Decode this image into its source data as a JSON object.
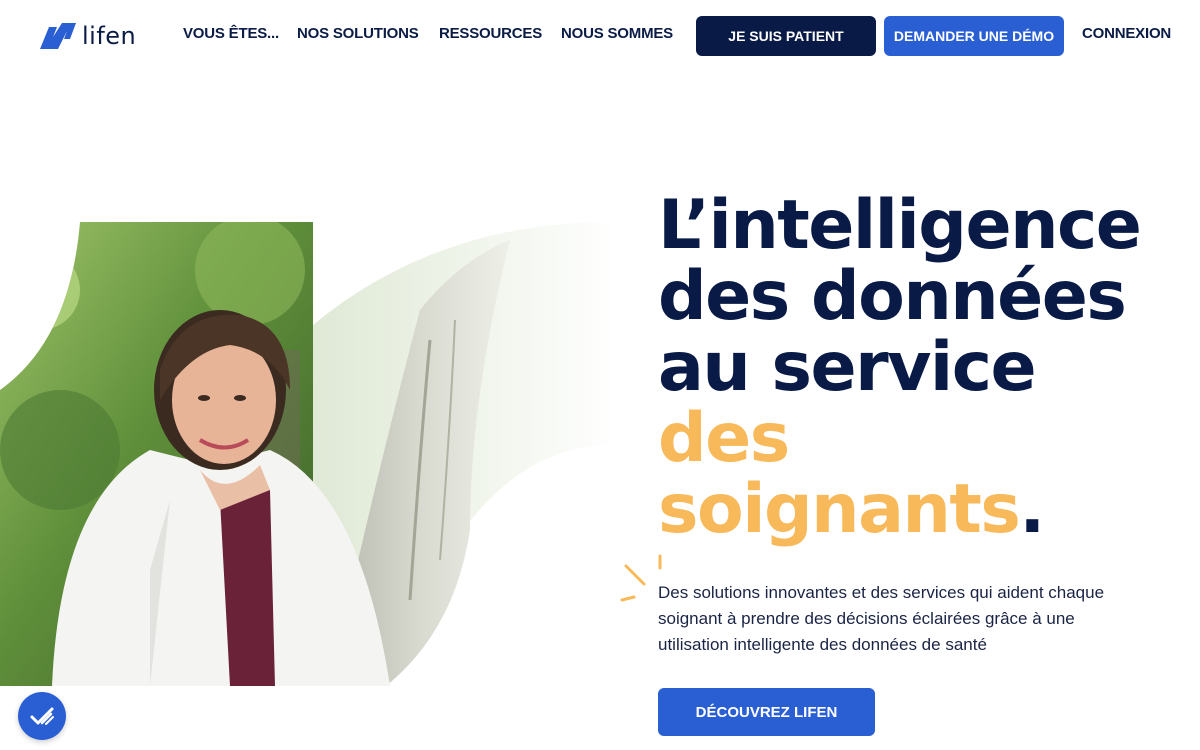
{
  "brand": {
    "name": "lifen",
    "color": "#2a5fd4"
  },
  "nav": {
    "items": [
      {
        "label": "VOUS ÊTES..."
      },
      {
        "label": "NOS SOLUTIONS"
      },
      {
        "label": "RESSOURCES"
      },
      {
        "label": "NOUS SOMMES"
      }
    ],
    "patient_button": "JE SUIS PATIENT",
    "demo_button": "DEMANDER UNE DÉMO",
    "login": "CONNEXION"
  },
  "hero": {
    "headline_lines": [
      "L’intelligence",
      "des données",
      "au service"
    ],
    "headline_accent_lines": [
      "des",
      "soignants"
    ],
    "headline_dot": ".",
    "lead": "Des solutions innovantes et des services qui aident chaque soignant à prendre des décisions éclairées grâce à une utilisation intelligente des données de santé",
    "cta": "DÉCOUVREZ LIFEN"
  },
  "colors": {
    "navy": "#081a45",
    "blue": "#2a5fd4",
    "accent": "#f7b95a"
  },
  "icons": {
    "logo": "lifen-logo-icon",
    "chat": "chat-badge-icon",
    "sparks": "sparkle-lines-icon"
  }
}
